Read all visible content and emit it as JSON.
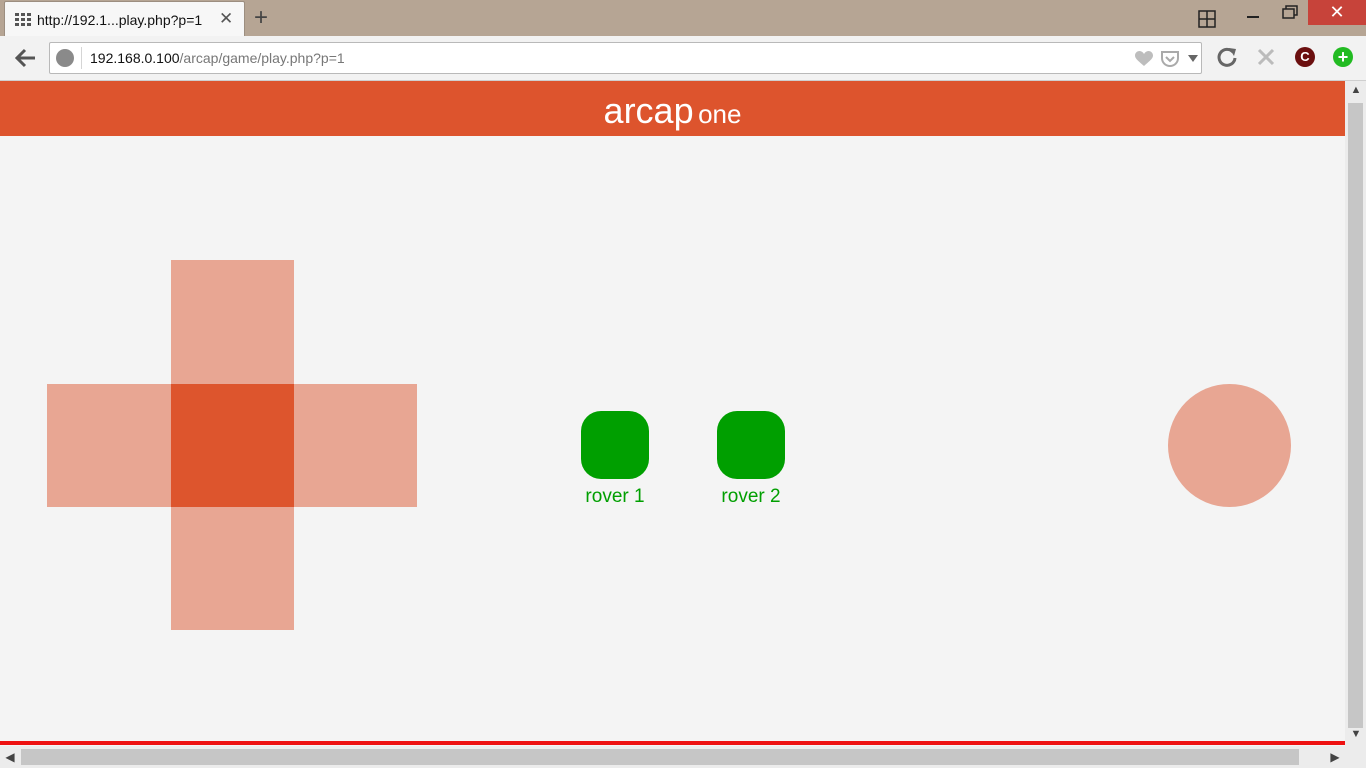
{
  "browser": {
    "tab_title": "http://192.1...play.php?p=1",
    "tab_close": "✕",
    "new_tab": "+",
    "window_close": "✕",
    "url_host": "192.168.0.100",
    "url_path": "/arcap/game/play.php?p=1",
    "ext_c_label": "C",
    "ext_plus_label": "+"
  },
  "header": {
    "brand": "arcap",
    "subtitle": "one"
  },
  "controls": {
    "rover1_label": "rover 1",
    "rover2_label": "rover 2"
  },
  "colors": {
    "accent": "#dd542d",
    "dpad_light": "#e8a693",
    "rover_green": "#009f00",
    "bottom_strip": "#ee1111"
  },
  "icons": [
    "apps-grid-icon",
    "back-arrow-icon",
    "site-info-icon",
    "heart-icon",
    "pocket-icon",
    "dropdown-icon",
    "reload-icon",
    "stop-icon",
    "extension-c-icon",
    "extension-plus-icon",
    "tiles-icon"
  ]
}
